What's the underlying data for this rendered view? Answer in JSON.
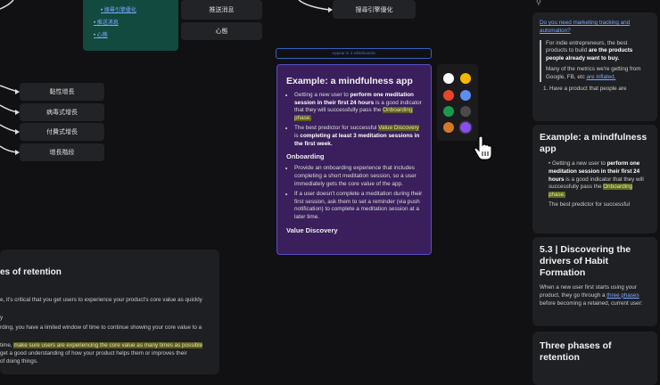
{
  "mindmap": {
    "green_links": [
      "搜尋引擎優化",
      "推送消息",
      "心態"
    ],
    "nodes_top": [
      "推送消息",
      "心態",
      "搜尋引擎優化"
    ],
    "nodes_left": [
      "黏性增長",
      "病毒式增長",
      "付費式增長",
      "增長階段"
    ]
  },
  "tag": "Appear in 2 whiteboards",
  "card": {
    "title": "Example: a mindfulness app",
    "b1a": "Getting a new user to ",
    "b1b": "perform one meditation session in their first 24 hours",
    "b1c": " is a good indicator that they will successfully pass the ",
    "b1d": "Onboarding phase.",
    "b2a": "The best predictor for successful ",
    "b2b": "Value Discovery",
    "b2c": " is ",
    "b2d": "completing at least 3 meditation sessions in the first week.",
    "h_onboarding": "Onboarding",
    "o1": "Provide an onboarding experience that includes completing a short meditation session, so a user immediately gets the core value of the app.",
    "o2": "If a user doesn't complete a meditation during their first session, ask them to set a reminder (via push notification) to complete a meditation session at a later time.",
    "h_value": "Value Discovery"
  },
  "palette": [
    "#ffffff",
    "#f5b800",
    "#e8462a",
    "#5b8ef0",
    "#1a9a50",
    "#4a4a4a",
    "#d4782a",
    "#8a4cf5"
  ],
  "bottom_left": {
    "title": "es of retention",
    "l1": "e, it's critical that you get users to experience your product's core value as quickly",
    "l2": "y",
    "l3": "rding, you have a limited window of time to continue showing your core value to a",
    "l4a": "time, ",
    "l4b": "make sure users are experiencing the core value as many times as possible",
    "l5": " get a good understanding of how your product helps them or improves their",
    "l6": " of doing things."
  },
  "right": {
    "search_placeholder": "",
    "c1_link": "Do you need marketing tracking and automation?",
    "c1_q1a": "For indie entrepreneurs, the best products to build ",
    "c1_q1b": "are the products people already want to buy.",
    "c1_q2a": "Many of the metrics we're getting from Google, FB, etc ",
    "c1_q2b": "are inflated.",
    "c1_li": "1. Have a product that people are",
    "c2_title": "Example: a mindfulness app",
    "c2_a": "Getting a new user to ",
    "c2_b": "perform one meditation session in their first 24 hours",
    "c2_c": " is a good indicator that they will successfully pass the ",
    "c2_d": "Onboarding phase.",
    "c2_e": "The best predictor for successful",
    "c3_title": "5.3 | Discovering the drivers of Habit Formation",
    "c3_a": "When a new user first starts using your product, they go through a ",
    "c3_b": "three phases",
    "c3_c": " before becoming a retained, current user:",
    "c4_title": "Three phases of retention"
  }
}
